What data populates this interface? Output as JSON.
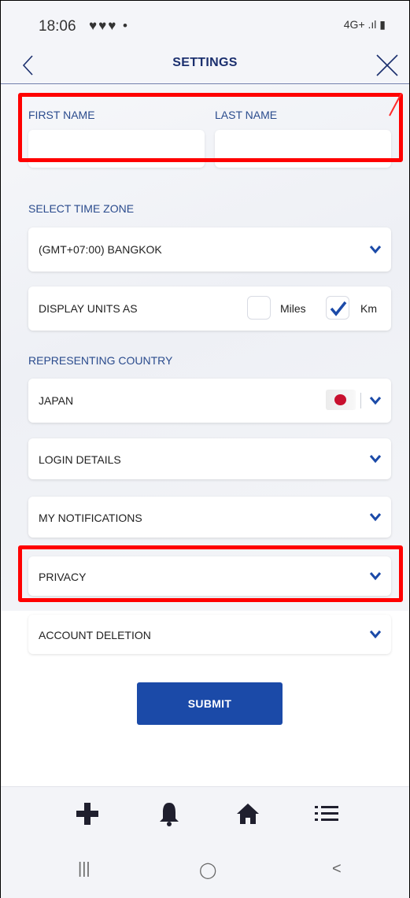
{
  "status": {
    "time": "18:06",
    "icons": "♥♥♥ •",
    "right": "4G+ .ıl ▮"
  },
  "header": {
    "title": "SETTINGS",
    "back_icon": "chevron-left-icon",
    "close_icon": "close-icon"
  },
  "name": {
    "first_label": "FIRST NAME",
    "last_label": "LAST NAME",
    "first_value": "",
    "last_value": ""
  },
  "timezone": {
    "label": "SELECT TIME ZONE",
    "value": "(GMT+07:00) BANGKOK"
  },
  "units": {
    "label": "DISPLAY UNITS AS",
    "miles_label": "Miles",
    "km_label": "Km",
    "miles_checked": false,
    "km_checked": true
  },
  "country": {
    "label": "REPRESENTING COUNTRY",
    "value": "JAPAN"
  },
  "sections": {
    "login": "LOGIN DETAILS",
    "notifications": "MY NOTIFICATIONS",
    "privacy": "PRIVACY",
    "deletion": "ACCOUNT DELETION"
  },
  "submit_label": "SUBMIT",
  "bottom_nav": [
    {
      "icon": "plus-icon"
    },
    {
      "icon": "bell-icon"
    },
    {
      "icon": "home-icon"
    },
    {
      "icon": "list-menu-icon"
    }
  ],
  "system_nav": {
    "recents": "|||",
    "home": "◯",
    "back": "<"
  },
  "colors": {
    "accent": "#1b4aa8",
    "label": "#2a4b8d",
    "highlight": "#ff0000"
  }
}
